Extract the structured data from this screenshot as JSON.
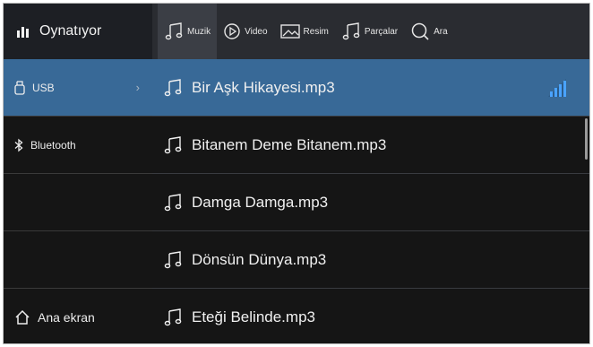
{
  "topbar": {
    "now_playing_label": "Oynatıyor",
    "tabs": [
      {
        "label": "Muzik",
        "icon": "music-note-icon",
        "active": true
      },
      {
        "label": "Video",
        "icon": "play-circle-icon",
        "active": false
      },
      {
        "label": "Resim",
        "icon": "image-icon",
        "active": false
      },
      {
        "label": "Parçalar",
        "icon": "music-note-icon",
        "active": false
      },
      {
        "label": "Ara",
        "icon": "search-icon",
        "active": false
      }
    ]
  },
  "sources": [
    {
      "label": "USB",
      "icon": "usb-icon",
      "selected": true
    },
    {
      "label": "Bluetooth",
      "icon": "bluetooth-icon",
      "selected": false
    },
    {
      "label": "",
      "icon": "",
      "selected": false
    },
    {
      "label": "",
      "icon": "",
      "selected": false
    },
    {
      "label": "Ana ekran",
      "icon": "home-icon",
      "selected": false
    }
  ],
  "files": [
    {
      "name": "Bir Aşk Hikayesi.mp3",
      "playing": true
    },
    {
      "name": "Bitanem Deme Bitanem.mp3",
      "playing": false
    },
    {
      "name": "Damga Damga.mp3",
      "playing": false
    },
    {
      "name": "Dönsün Dünya.mp3",
      "playing": false
    },
    {
      "name": "Eteği Belinde.mp3",
      "playing": false
    }
  ],
  "colors": {
    "background": "#151515",
    "selection": "#386997",
    "topbar": "#2a2c31",
    "accent_bars": "#4aa3ff"
  },
  "source_chevron": "›"
}
